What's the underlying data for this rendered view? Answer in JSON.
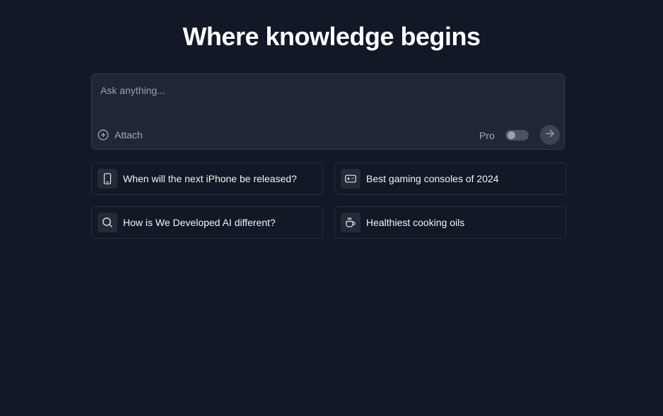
{
  "header": {
    "title": "Where knowledge begins"
  },
  "ask": {
    "placeholder": "Ask anything...",
    "value": "",
    "attach_label": "Attach",
    "attach_icon": "plus-circle-icon",
    "pro_label": "Pro",
    "pro_enabled": false,
    "send_icon": "arrow-right-icon"
  },
  "suggestions": [
    {
      "label": "When will the next iPhone be released?",
      "icon": "smartphone-icon"
    },
    {
      "label": "Best gaming consoles of 2024",
      "icon": "gamepad-icon"
    },
    {
      "label": "How is We Developed AI different?",
      "icon": "search-icon"
    },
    {
      "label": "Healthiest cooking oils",
      "icon": "coffee-cup-icon"
    }
  ],
  "colors": {
    "background": "#121826",
    "input_background": "#1f2736",
    "card_border": "#262e3d",
    "text": "#ffffff",
    "muted_text": "#a3a8b2"
  }
}
